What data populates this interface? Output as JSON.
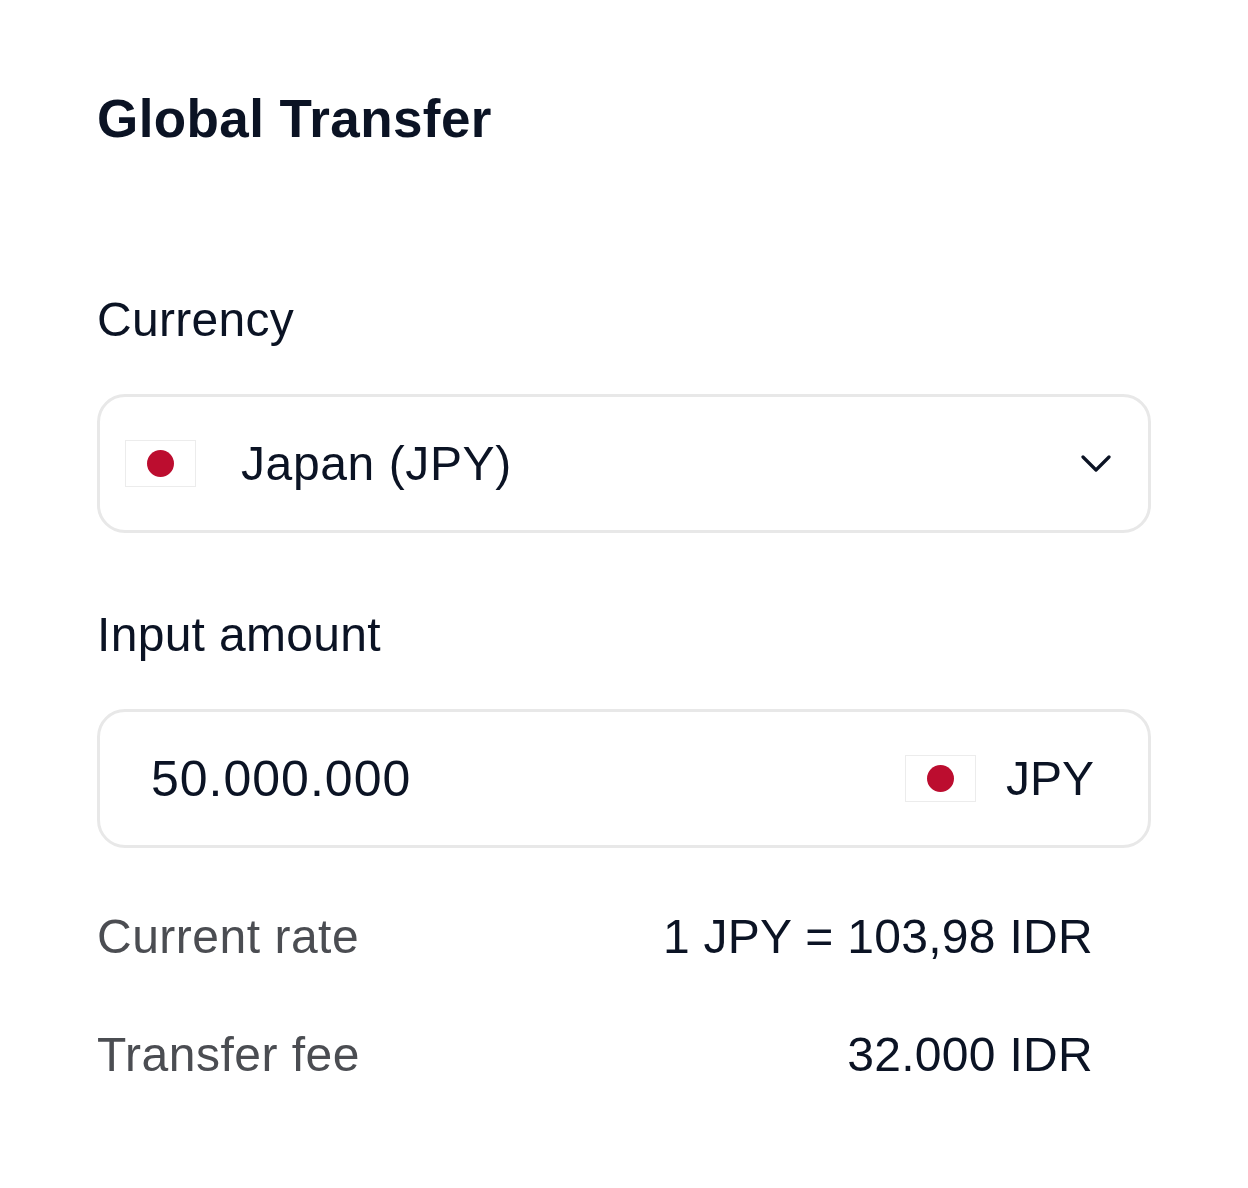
{
  "title": "Global Transfer",
  "currency": {
    "label": "Currency",
    "value": "Japan (JPY)"
  },
  "amount": {
    "label": "Input amount",
    "value": "50.000.000",
    "currency": "JPY"
  },
  "details": [
    {
      "label": "Current rate",
      "value": "1 JPY = 103,98 IDR"
    },
    {
      "label": "Transfer fee",
      "value": "32.000 IDR"
    }
  ]
}
